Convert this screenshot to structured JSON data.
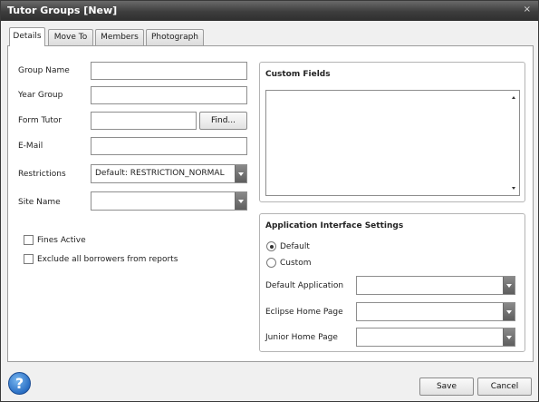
{
  "window": {
    "title": "Tutor Groups [New]",
    "close_glyph": "×"
  },
  "tabs": [
    {
      "label": "Details",
      "active": true
    },
    {
      "label": "Move To",
      "active": false
    },
    {
      "label": "Members",
      "active": false
    },
    {
      "label": "Photograph",
      "active": false
    }
  ],
  "details": {
    "group_name_label": "Group Name",
    "group_name_value": "",
    "year_group_label": "Year Group",
    "year_group_value": "",
    "form_tutor_label": "Form Tutor",
    "form_tutor_value": "",
    "find_button": "Find...",
    "email_label": "E-Mail",
    "email_value": "",
    "restrictions_label": "Restrictions",
    "restrictions_value": "Default: RESTRICTION_NORMAL",
    "site_name_label": "Site Name",
    "site_name_value": "",
    "fines_active_label": "Fines Active",
    "fines_active_checked": false,
    "exclude_label": "Exclude all borrowers from reports",
    "exclude_checked": false
  },
  "custom_fields": {
    "title": "Custom Fields"
  },
  "app_settings": {
    "title": "Application Interface Settings",
    "radio_default": "Default",
    "radio_custom": "Custom",
    "selected": "Default",
    "default_application_label": "Default Application",
    "default_application_value": "",
    "eclipse_home_label": "Eclipse Home Page",
    "eclipse_home_value": "",
    "junior_home_label": "Junior Home Page",
    "junior_home_value": ""
  },
  "footer": {
    "help_glyph": "?",
    "save": "Save",
    "cancel": "Cancel"
  },
  "colors": {
    "titlebar": "#3d3d3d",
    "help_blue": "#2a6fc4"
  }
}
